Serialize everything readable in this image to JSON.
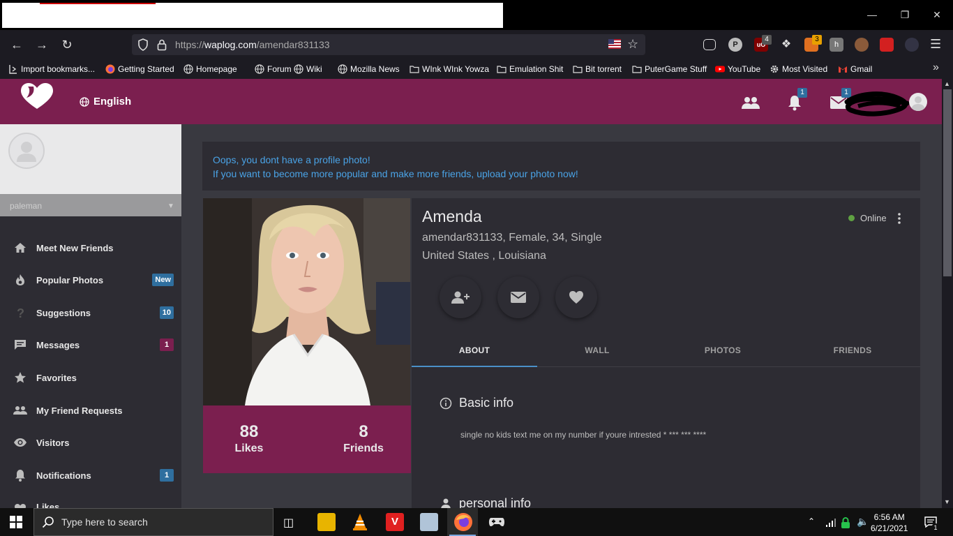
{
  "browser": {
    "url_prefix": "https://",
    "url_host": "waplog.com",
    "url_path": "/amendar831133",
    "bookmarks": [
      {
        "label": "Import bookmarks...",
        "icon": "import-icon"
      },
      {
        "label": "Getting Started",
        "icon": "firefox-icon"
      },
      {
        "label": "Homepage",
        "icon": "globe-icon"
      },
      {
        "label": "Forum",
        "icon": "globe-icon"
      },
      {
        "label": "Wiki",
        "icon": "globe-icon"
      },
      {
        "label": "Mozilla News",
        "icon": "globe-icon"
      },
      {
        "label": "WInk WInk Yowza",
        "icon": "folder-icon"
      },
      {
        "label": "Emulation Shit",
        "icon": "folder-icon"
      },
      {
        "label": "Bit torrent",
        "icon": "folder-icon"
      },
      {
        "label": "PuterGame Stuff",
        "icon": "folder-icon"
      },
      {
        "label": "YouTube",
        "icon": "youtube-icon"
      },
      {
        "label": "Most Visited",
        "icon": "gear-icon"
      },
      {
        "label": "Gmail",
        "icon": "gmail-icon"
      }
    ],
    "ext_badges": {
      "ublock": "4",
      "ext3": "3"
    }
  },
  "header": {
    "language": "English",
    "notifications_badge": "1",
    "messages_badge": "1"
  },
  "sidebar": {
    "username": "paleman",
    "items": [
      {
        "label": "Meet New Friends",
        "icon": "home-icon",
        "badge": ""
      },
      {
        "label": "Popular Photos",
        "icon": "fire-icon",
        "badge": "New"
      },
      {
        "label": "Suggestions",
        "icon": "question-icon",
        "badge": "10"
      },
      {
        "label": "Messages",
        "icon": "chat-icon",
        "badge": "1"
      },
      {
        "label": "Favorites",
        "icon": "star-icon",
        "badge": ""
      },
      {
        "label": "My Friend Requests",
        "icon": "people-icon",
        "badge": ""
      },
      {
        "label": "Visitors",
        "icon": "eye-icon",
        "badge": ""
      },
      {
        "label": "Notifications",
        "icon": "bell-icon",
        "badge": "1"
      },
      {
        "label": "Likes",
        "icon": "heart-icon",
        "badge": ""
      }
    ]
  },
  "notice": {
    "line1": "Oops, you dont have a profile photo!",
    "line2": "If you want to become more popular and make more friends, upload your photo now!"
  },
  "profile": {
    "name": "Amenda",
    "details": "amendar831133, Female, 34, Single",
    "location": "United States , Louisiana",
    "status": "Online",
    "likes_count": "88",
    "likes_label": "Likes",
    "friends_count": "8",
    "friends_label": "Friends"
  },
  "tabs": [
    "ABOUT",
    "WALL",
    "PHOTOS",
    "FRIENDS"
  ],
  "about": {
    "basic_info_title": "Basic info",
    "bio": "single no kids text me on my number if youre intrested * *** *** ****",
    "personal_info_title": "personal info"
  },
  "taskbar": {
    "search_placeholder": "Type here to search",
    "time": "6:56 AM",
    "date": "6/21/2021",
    "action_center_badge": "1"
  },
  "colors": {
    "brand": "#7b1f4f",
    "link": "#4aa3e6",
    "online": "#5fa142",
    "badge_blue": "#2f6f9f",
    "badge_maroon": "#7b1f4f"
  }
}
